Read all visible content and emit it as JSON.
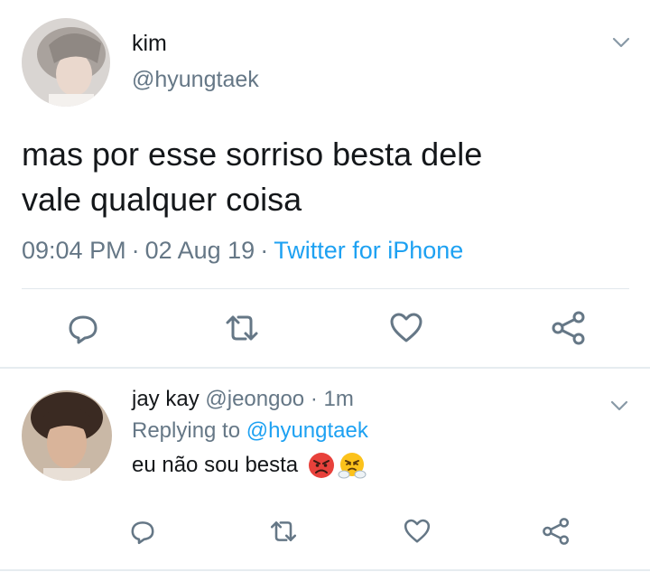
{
  "main_tweet": {
    "author_name": "kim",
    "author_handle": "@hyungtaek",
    "text_line1": "mas por esse sorriso besta dele",
    "text_line2": "vale qualquer coisa",
    "time": "09:04 PM",
    "date": "02 Aug 19",
    "separator": "·",
    "source": "Twitter for iPhone",
    "actions": [
      "reply-icon",
      "retweet-icon",
      "like-icon",
      "share-icon"
    ]
  },
  "reply_tweet": {
    "author_name": "jay kay",
    "author_handle": "@jeongoo",
    "separator": "·",
    "time": "1m",
    "replying_prefix": "Replying to",
    "replying_to": "@hyungtaek",
    "text": "eu não sou besta",
    "emojis": [
      "angry-face-emoji",
      "steam-from-nose-emoji"
    ],
    "actions": [
      "reply-icon",
      "retweet-icon",
      "like-icon",
      "share-icon"
    ]
  },
  "colors": {
    "text": "#14171a",
    "secondary": "#657786",
    "link": "#1da1f2",
    "icon": "#657786",
    "divider": "#e1e8ed"
  }
}
